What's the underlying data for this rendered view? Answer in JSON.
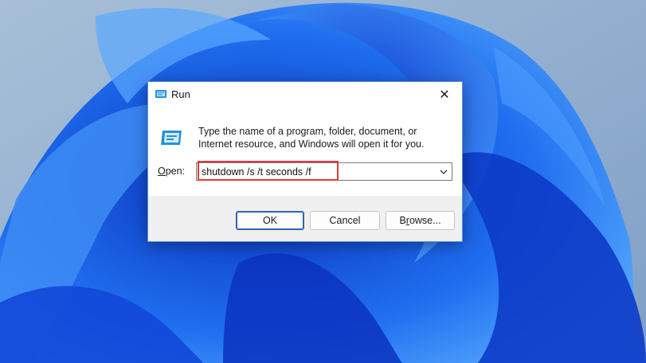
{
  "window": {
    "title": "Run",
    "close_glyph": "✕"
  },
  "dialog": {
    "description": "Type the name of a program, folder, document, or Internet resource, and Windows will open it for you.",
    "open_label_mnemonic": "O",
    "open_label_rest": "pen:",
    "input_value": "shutdown /s /t seconds /f"
  },
  "buttons": {
    "ok": "OK",
    "cancel": "Cancel",
    "browse_pre": "B",
    "browse_mnemonic": "r",
    "browse_post": "owse..."
  },
  "icons": {
    "title": "run-icon",
    "main": "run-icon",
    "close": "close-icon",
    "dropdown": "chevron-down-icon"
  },
  "colors": {
    "wallpaper_blue": "#1f5fe0",
    "highlight": "#e23a3a",
    "ok_border": "#2f63b5"
  }
}
